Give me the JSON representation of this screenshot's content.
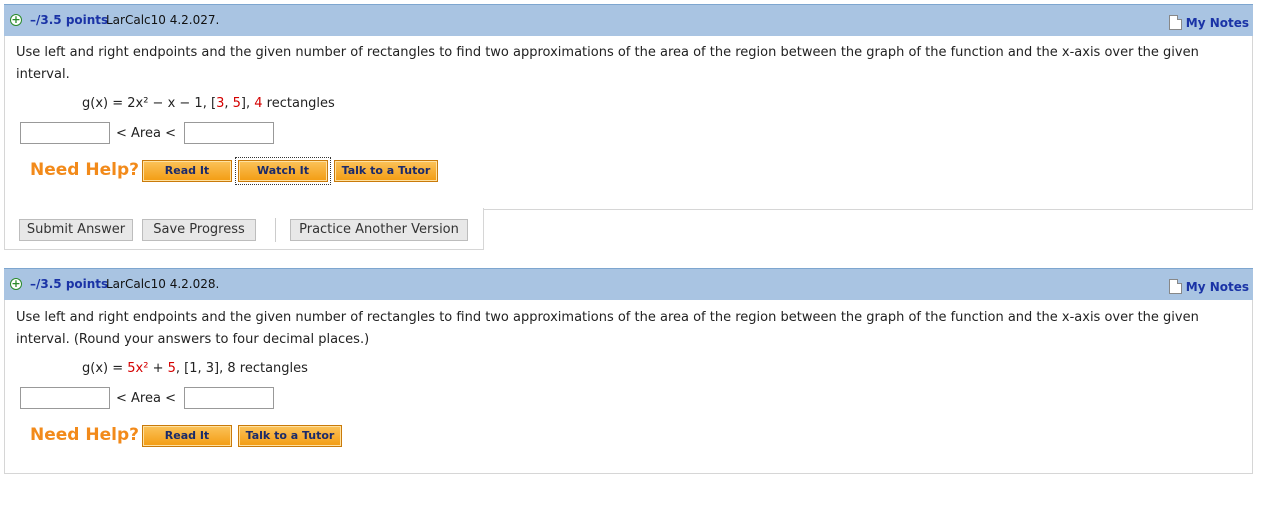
{
  "q1": {
    "points": "–/3.5 points",
    "source": "LarCalc10 4.2.027.",
    "notes": "My Notes",
    "problem": "Use left and right endpoints and the given number of rectangles to find two approximations of the area of the region between the graph of the function and the x-axis over the given interval.",
    "formula": {
      "fn": "g(x) = 2x² − x − 1,",
      "bracket_open": "[",
      "a": "3",
      "comma": ", ",
      "b": "5",
      "bracket_close": "],",
      "n": "4",
      "rect": "rectangles"
    },
    "area_label": "< Area <",
    "need_help": "Need Help?",
    "buttons": {
      "read": "Read It",
      "watch": "Watch It",
      "tutor": "Talk to a Tutor"
    }
  },
  "actions": {
    "submit": "Submit Answer",
    "save": "Save Progress",
    "practice": "Practice Another Version"
  },
  "q2": {
    "points": "–/3.5 points",
    "source": "LarCalc10 4.2.028.",
    "notes": "My Notes",
    "problem": "Use left and right endpoints and the given number of rectangles to find two approximations of the area of the region between the graph of the function and the x-axis over the given interval. (Round your answers to four decimal places.)",
    "formula": {
      "fn": "g(x) = ",
      "coef": "5x²",
      "plus": " + ",
      "const": "5",
      "rest": ", [1, 3], 8 rectangles"
    },
    "area_label": "< Area <",
    "need_help": "Need Help?",
    "buttons": {
      "read": "Read It",
      "tutor": "Talk to a Tutor"
    }
  }
}
